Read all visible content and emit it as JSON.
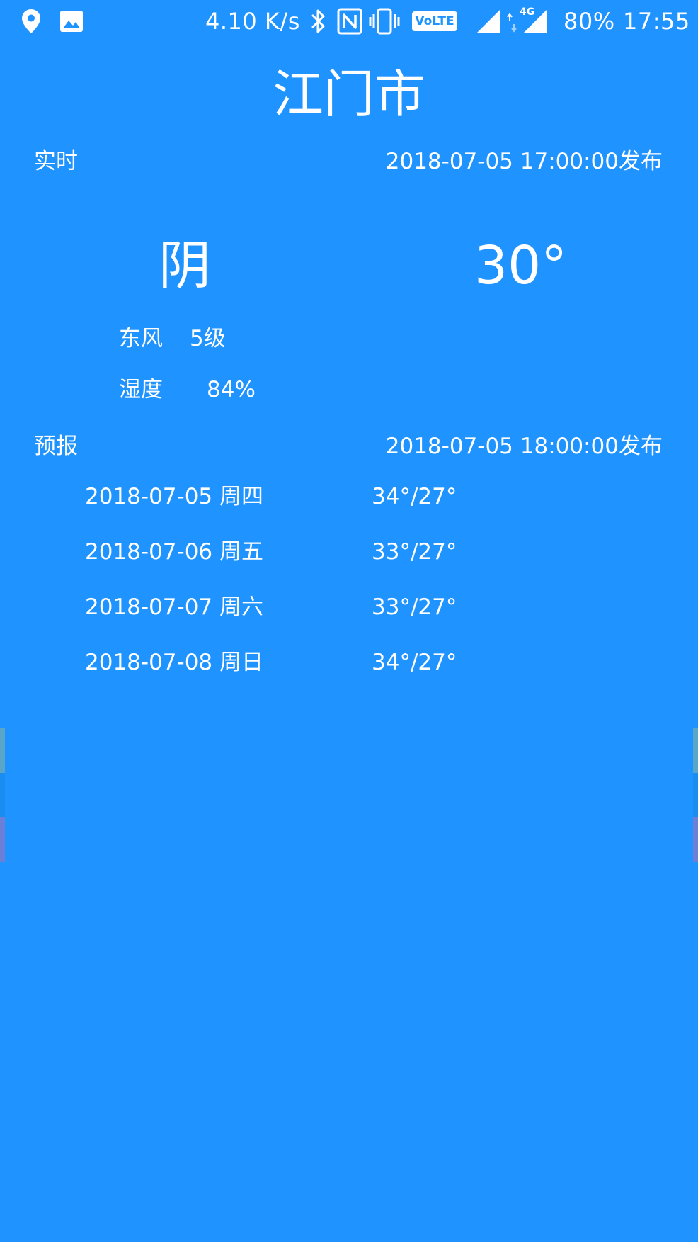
{
  "status_bar": {
    "speed": "4.10 K/s",
    "battery": "80%",
    "time": "17:55",
    "volte": "VoLTE",
    "network": "4G",
    "icons": [
      "location-icon",
      "image-icon",
      "bluetooth-icon",
      "nfc-icon",
      "vibrate-icon",
      "volte-icon",
      "signal-icon",
      "signal-4g-icon"
    ]
  },
  "city": "江门市",
  "realtime": {
    "label": "实时",
    "published": "2018-07-05 17:00:00发布",
    "condition": "阴",
    "temperature": "30°",
    "wind_label": "东风",
    "wind_value": "5级",
    "humidity_label": "湿度",
    "humidity_value": "84%"
  },
  "forecast": {
    "label": "预报",
    "published": "2018-07-05 18:00:00发布",
    "days": [
      {
        "date": "2018-07-05 周四",
        "temp": "34°/27°"
      },
      {
        "date": "2018-07-06 周五",
        "temp": "33°/27°"
      },
      {
        "date": "2018-07-07 周六",
        "temp": "33°/27°"
      },
      {
        "date": "2018-07-08 周日",
        "temp": "34°/27°"
      }
    ]
  },
  "colors": {
    "background": "#1f93ff",
    "text": "#ffffff"
  }
}
